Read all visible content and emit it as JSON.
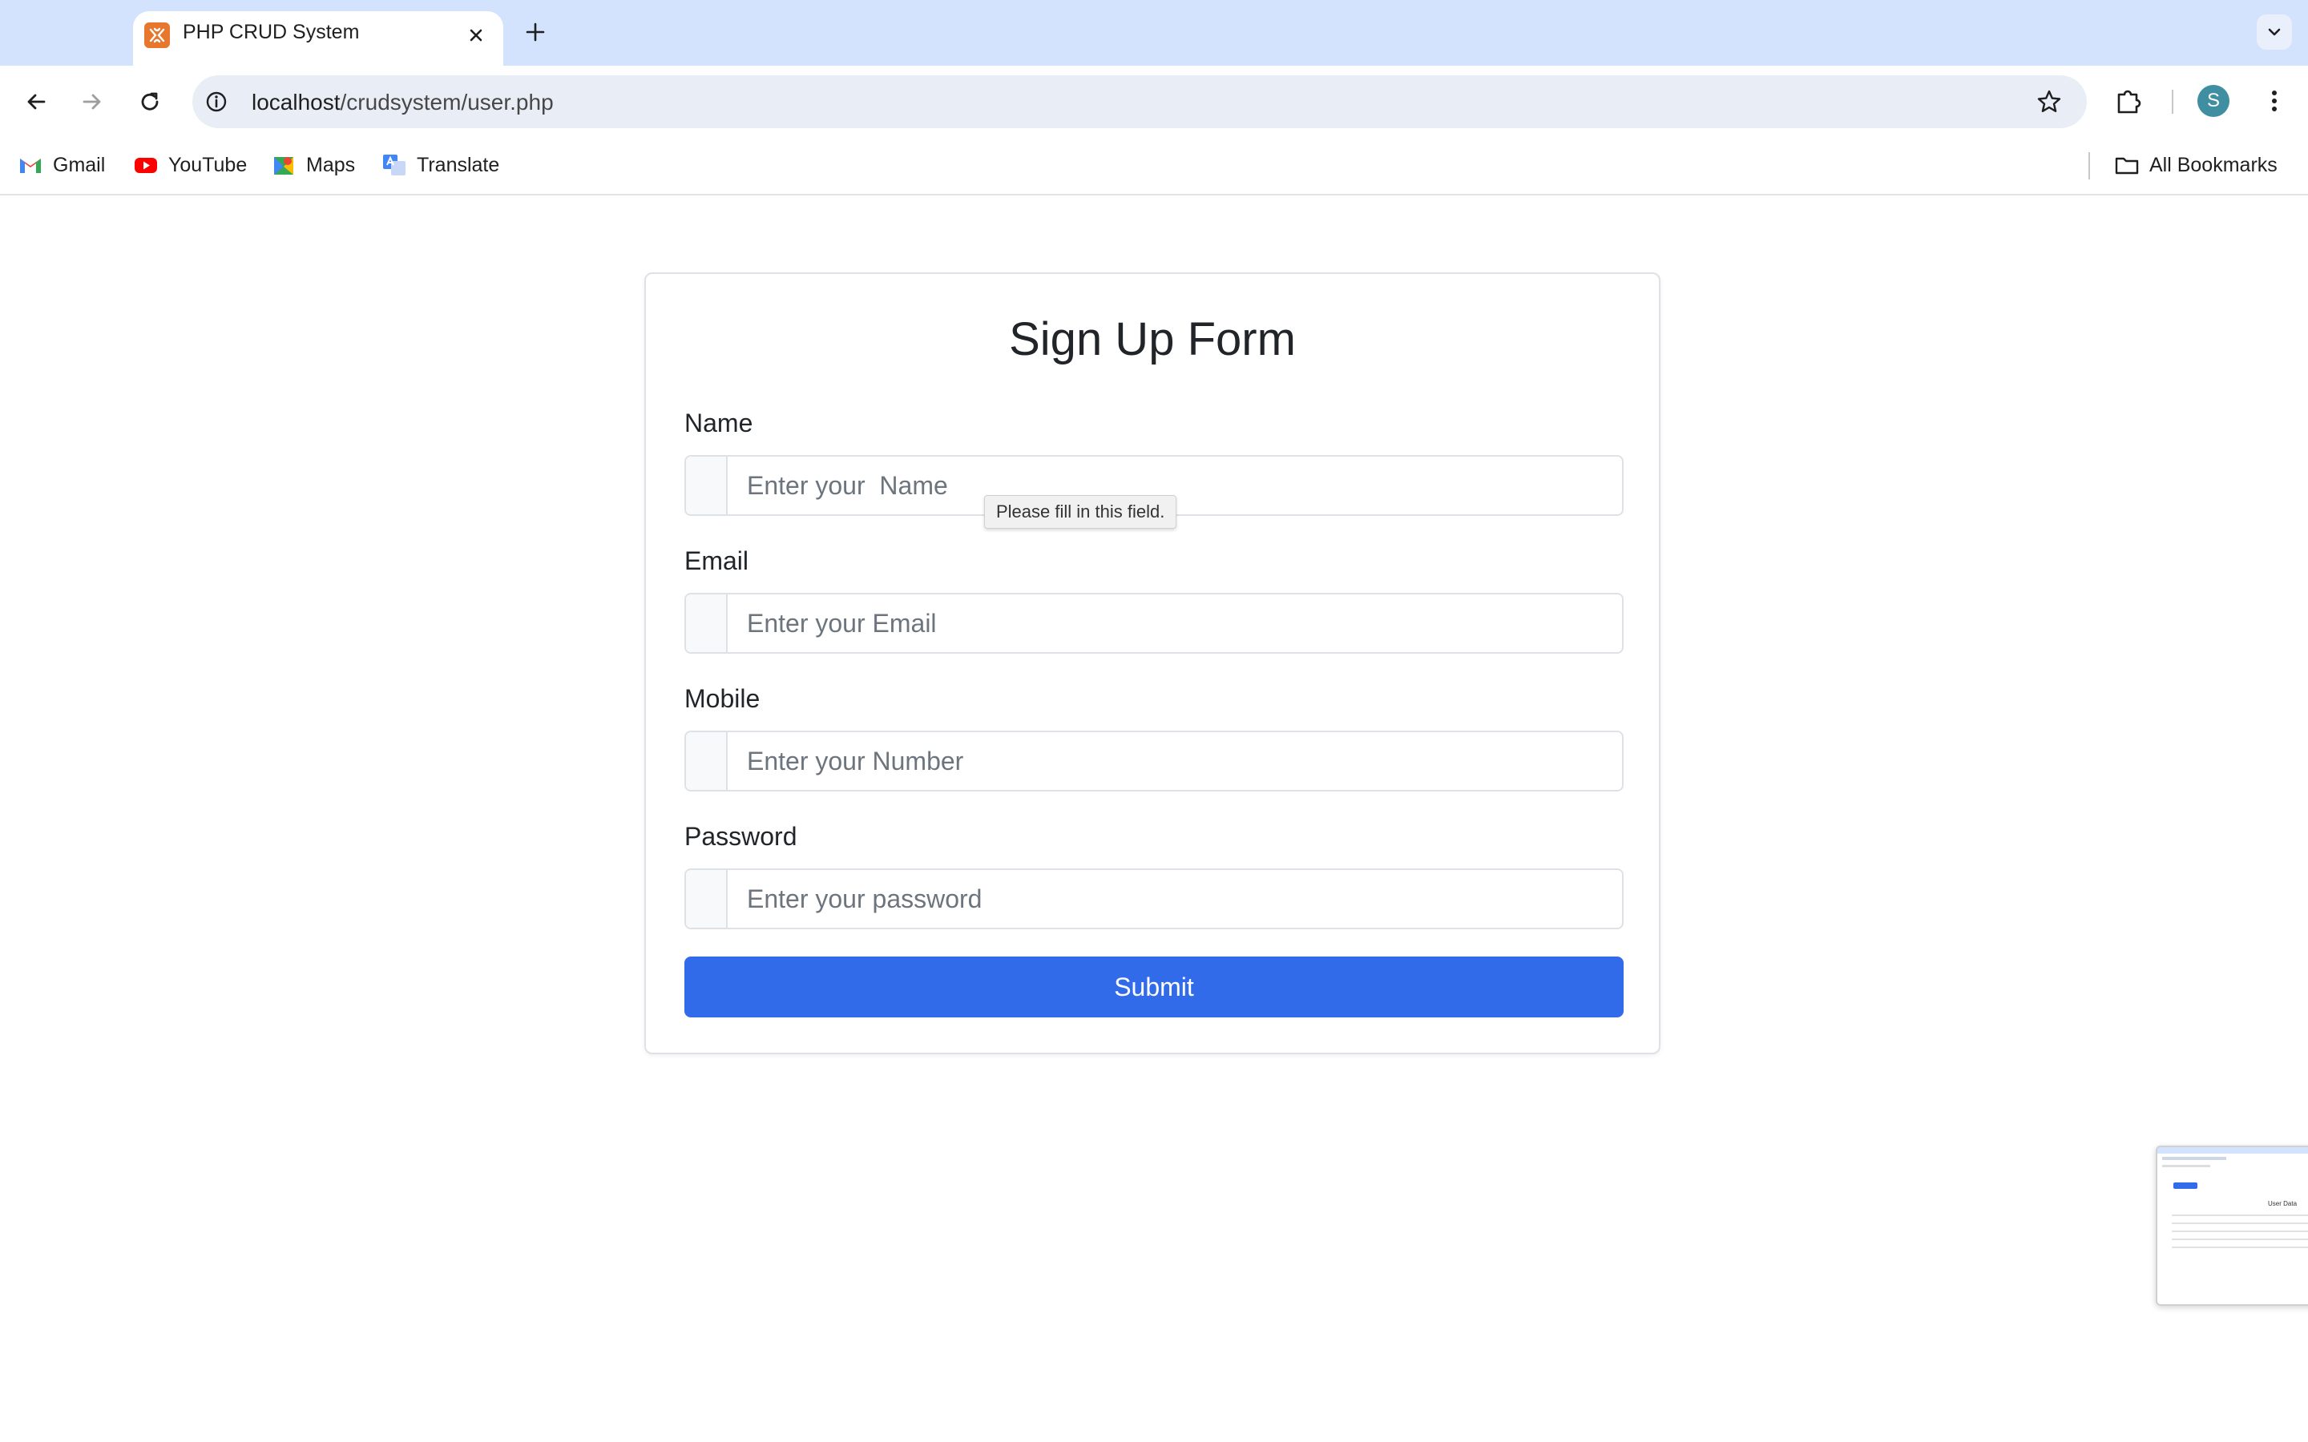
{
  "browser": {
    "tab": {
      "title": "PHP CRUD System",
      "favicon": "xampp-icon"
    },
    "address_bar": {
      "host": "localhost",
      "path": "/crudsystem/user.php"
    },
    "avatar_initial": "S",
    "bookmarks": [
      {
        "label": "Gmail",
        "icon": "gmail-icon"
      },
      {
        "label": "YouTube",
        "icon": "youtube-icon"
      },
      {
        "label": "Maps",
        "icon": "maps-icon"
      },
      {
        "label": "Translate",
        "icon": "translate-icon"
      }
    ],
    "all_bookmarks_label": "All Bookmarks"
  },
  "form": {
    "title": "Sign Up Form",
    "fields": [
      {
        "label": "Name",
        "placeholder": "Enter your  Name",
        "value": ""
      },
      {
        "label": "Email",
        "placeholder": "Enter your Email",
        "value": ""
      },
      {
        "label": "Mobile",
        "placeholder": "Enter your Number",
        "value": ""
      },
      {
        "label": "Password",
        "placeholder": "Enter your password",
        "value": ""
      }
    ],
    "submit_label": "Submit",
    "validation_tooltip": "Please fill in this field."
  },
  "thumbnail": {
    "title": "User Data"
  },
  "colors": {
    "primary": "#316bea",
    "tab_strip": "#d3e3fd",
    "omnibox": "#e9eef6"
  }
}
